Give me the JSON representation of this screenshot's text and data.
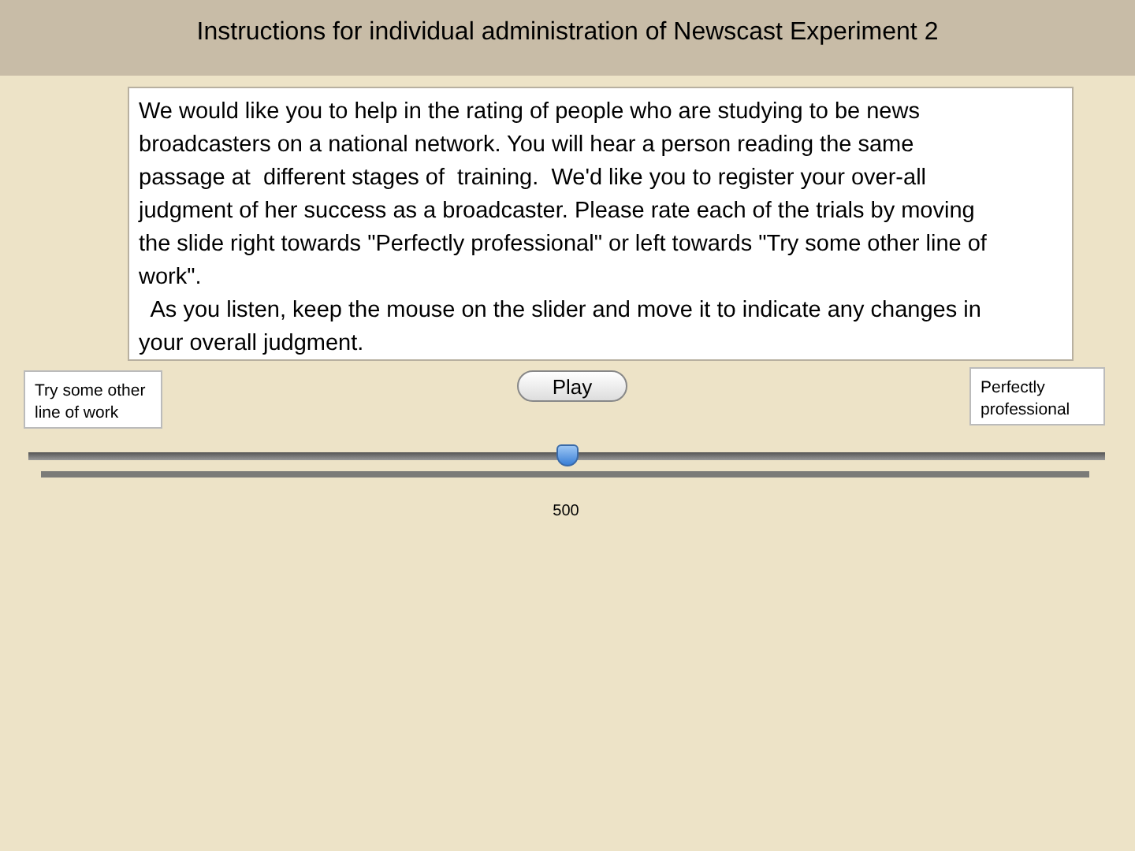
{
  "window": {
    "title": "Instructions for individual administration of Newscast Experiment 2"
  },
  "instructions": "We would like you to help in the rating of people who are studying to be news\nbroadcasters on a national network. You will hear a person reading the same\npassage at  different stages of  training.  We'd like you to register your over-all\njudgment of her success as a broadcaster. Please rate each of the trials by moving\nthe slide right towards \"Perfectly professional\" or left towards \"Try some other line of\nwork\".\n  As you listen, keep the mouse on the slider and move it to indicate any changes in\nyour overall judgment.",
  "play_button": "Play",
  "left_label": "Try some other line of work",
  "right_label": "Perfectly professional",
  "slider": {
    "level": 0.5,
    "reading": "500"
  }
}
